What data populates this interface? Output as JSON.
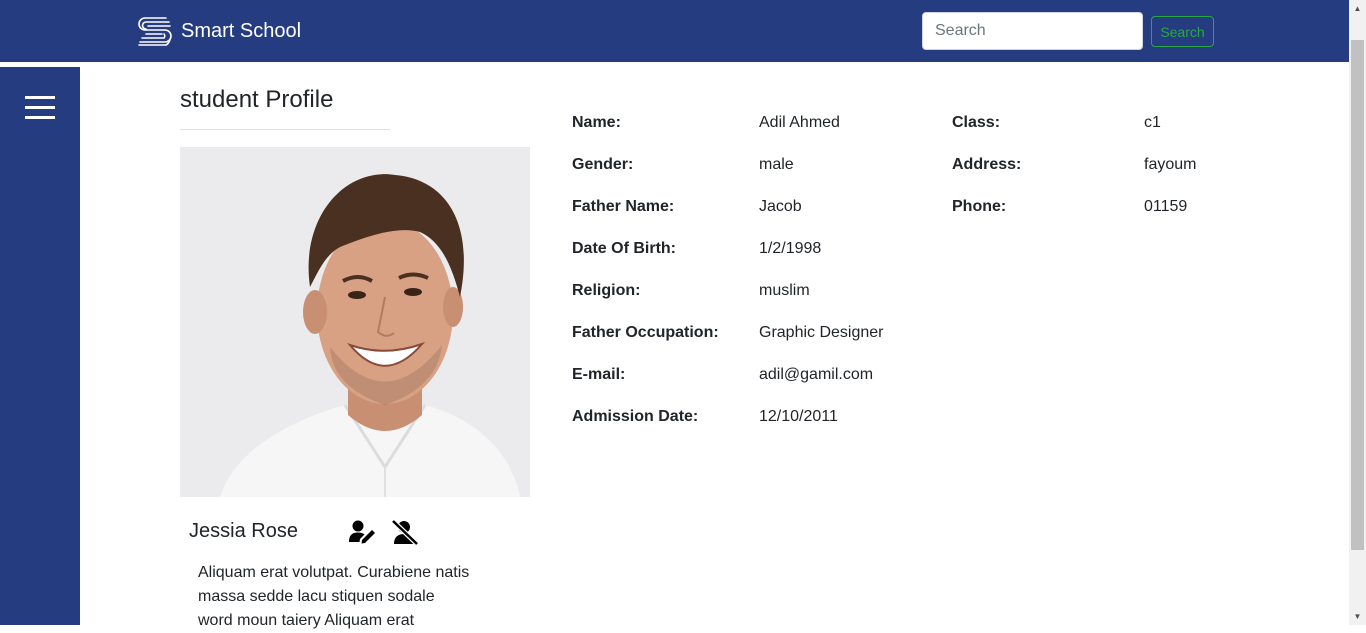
{
  "navbar": {
    "brand": "Smart School",
    "logo_icon": "smart-school-logo-icon",
    "search_placeholder": "Search",
    "search_button": "Search",
    "bg_color": "#263c80",
    "search_button_color": "#28a745"
  },
  "sidebar": {
    "menu_icon": "hamburger-menu-icon",
    "bg_color": "#263c80"
  },
  "profile": {
    "heading": "student Profile",
    "photo_icon": "student-photo",
    "name": "Jessia Rose",
    "edit_icon": "user-edit-icon",
    "remove_icon": "user-slash-icon",
    "bio": "Aliquam erat volutpat. Curabiene natis massa sedde lacu stiquen sodale word moun taiery Aliquam erat"
  },
  "details": {
    "left": [
      {
        "label": "Name:",
        "value": "Adil Ahmed"
      },
      {
        "label": "Gender:",
        "value": "male"
      },
      {
        "label": "Father Name:",
        "value": "Jacob"
      },
      {
        "label": "Date Of Birth:",
        "value": "1/2/1998"
      },
      {
        "label": "Religion:",
        "value": "muslim"
      },
      {
        "label": "Father Occupation:",
        "value": "Graphic Designer"
      },
      {
        "label": "E-mail:",
        "value": "adil@gamil.com"
      },
      {
        "label": "Admission Date:",
        "value": "12/10/2011"
      }
    ],
    "right": [
      {
        "label": "Class:",
        "value": "c1"
      },
      {
        "label": "Address:",
        "value": "fayoum"
      },
      {
        "label": "Phone:",
        "value": "01159"
      }
    ]
  }
}
